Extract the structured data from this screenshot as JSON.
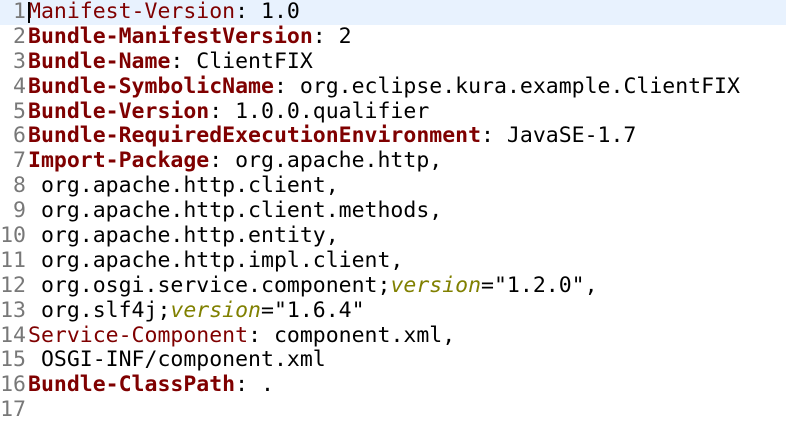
{
  "editor": {
    "current_line": 1,
    "colors": {
      "key": "#7f0000",
      "attribute": "#808000",
      "current_line_bg": "#e8f2fe"
    },
    "lines": [
      {
        "n": "1",
        "segs": [
          {
            "t": "Manifest-Version",
            "s": "key"
          },
          {
            "t": ": 1.0",
            "s": "plain"
          }
        ]
      },
      {
        "n": "2",
        "segs": [
          {
            "t": "Bundle-ManifestVersion",
            "s": "key bold"
          },
          {
            "t": ": 2",
            "s": "plain"
          }
        ]
      },
      {
        "n": "3",
        "segs": [
          {
            "t": "Bundle-Name",
            "s": "key bold"
          },
          {
            "t": ": ClientFIX",
            "s": "plain"
          }
        ]
      },
      {
        "n": "4",
        "segs": [
          {
            "t": "Bundle-SymbolicName",
            "s": "key bold"
          },
          {
            "t": ": org.eclipse.kura.example.ClientFIX",
            "s": "plain"
          }
        ]
      },
      {
        "n": "5",
        "segs": [
          {
            "t": "Bundle-Version",
            "s": "key bold"
          },
          {
            "t": ": 1.0.0.qualifier",
            "s": "plain"
          }
        ]
      },
      {
        "n": "6",
        "segs": [
          {
            "t": "Bundle-RequiredExecutionEnvironment",
            "s": "key bold"
          },
          {
            "t": ": JavaSE-1.7",
            "s": "plain"
          }
        ]
      },
      {
        "n": "7",
        "segs": [
          {
            "t": "Import-Package",
            "s": "key bold"
          },
          {
            "t": ": org.apache.http,",
            "s": "plain"
          }
        ]
      },
      {
        "n": "8",
        "segs": [
          {
            "t": " org.apache.http.client,",
            "s": "plain"
          }
        ]
      },
      {
        "n": "9",
        "segs": [
          {
            "t": " org.apache.http.client.methods,",
            "s": "plain"
          }
        ]
      },
      {
        "n": "10",
        "segs": [
          {
            "t": " org.apache.http.entity,",
            "s": "plain"
          }
        ]
      },
      {
        "n": "11",
        "segs": [
          {
            "t": " org.apache.http.impl.client,",
            "s": "plain"
          }
        ]
      },
      {
        "n": "12",
        "segs": [
          {
            "t": " org.osgi.service.component;",
            "s": "plain"
          },
          {
            "t": "version",
            "s": "attr"
          },
          {
            "t": "=\"1.2.0\",",
            "s": "plain"
          }
        ]
      },
      {
        "n": "13",
        "segs": [
          {
            "t": " org.slf4j;",
            "s": "plain"
          },
          {
            "t": "version",
            "s": "attr"
          },
          {
            "t": "=\"1.6.4\"",
            "s": "plain"
          }
        ]
      },
      {
        "n": "14",
        "segs": [
          {
            "t": "Service-Component",
            "s": "key"
          },
          {
            "t": ": component.xml,",
            "s": "plain"
          }
        ]
      },
      {
        "n": "15",
        "segs": [
          {
            "t": " OSGI-INF/component.xml",
            "s": "plain"
          }
        ]
      },
      {
        "n": "16",
        "segs": [
          {
            "t": "Bundle-ClassPath",
            "s": "key bold"
          },
          {
            "t": ": .",
            "s": "plain"
          }
        ]
      },
      {
        "n": "17",
        "segs": []
      }
    ]
  }
}
